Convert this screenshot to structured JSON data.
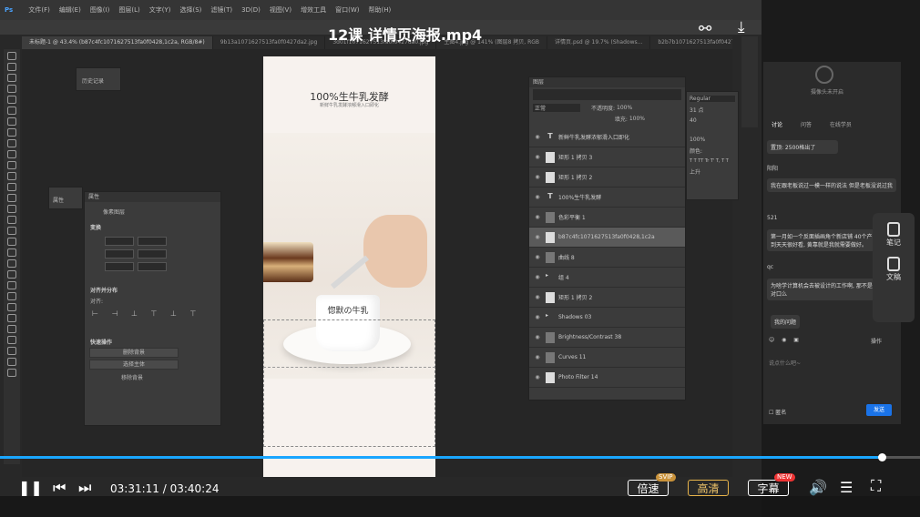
{
  "video": {
    "title": "12课 详情页海报.mp4",
    "timecode": "03:31:11 / 03:40:24",
    "progress": 0.958,
    "speed_label": "倍速",
    "speed_badge": "SVIP",
    "quality_label": "高清",
    "subtitle_label": "字幕",
    "subtitle_badge": "NEW"
  },
  "ps": {
    "menu": [
      "文件(F)",
      "编辑(E)",
      "图像(I)",
      "图层(L)",
      "文字(Y)",
      "选择(S)",
      "滤镜(T)",
      "3D(D)",
      "视图(V)",
      "增效工具",
      "窗口(W)",
      "帮助(H)"
    ],
    "tabs": [
      "未标题-1 @ 43.4% (b87c4fc1071627513fa0f0428,1c2a, RGB/8#)",
      "9b13a1071627513fa0f0427da2.jpg",
      "3d01f1071627513fa0f0427da0.jpg",
      "主图4.jpg @ 141% (图层8 拷贝, RGB",
      "详情页.psd @ 19.7% (Shadows...",
      "b2b7b1071627513fa0f0427c.8e"
    ],
    "history_label": "历史记录",
    "properties_collapsed_label": "属性",
    "properties": {
      "title": "属性",
      "subtitle": "像素图层",
      "transform_label": "变换",
      "align_label": "对齐并分布",
      "align_sub": "对齐:",
      "quick_label": "快速操作",
      "btn_remove_bg": "删除背景",
      "btn_select_subject": "选择主体",
      "btn_more": "...",
      "footer": "移除背景"
    },
    "layers": {
      "title": "图层",
      "blend_mode": "正常",
      "opacity_label": "不透明度:",
      "opacity_value": "100%",
      "fill_label": "填充:",
      "fill_value": "100%",
      "rows": [
        {
          "type": "text",
          "name": "新鲜牛乳发酵浓郁滑入口即化"
        },
        {
          "type": "shape",
          "name": "矩形 1 拷贝 3"
        },
        {
          "type": "shape",
          "name": "矩形 1 拷贝 2"
        },
        {
          "type": "text",
          "name": "100%生牛乳发酵"
        },
        {
          "type": "adj",
          "name": "色彩平衡 1"
        },
        {
          "type": "image",
          "name": "b87c4fc1071627513fa0f0428,1c2a"
        },
        {
          "type": "adj",
          "name": "曲线 8"
        },
        {
          "type": "group",
          "name": "组 4"
        },
        {
          "type": "shape",
          "name": "矩形 1 拷贝 2"
        },
        {
          "type": "group",
          "name": "Shadows 03"
        },
        {
          "type": "adj",
          "name": "Brightness/Contrast 38"
        },
        {
          "type": "adj",
          "name": "Curves 11"
        },
        {
          "type": "image",
          "name": "Photo Filter 14"
        }
      ]
    },
    "character": {
      "font_style": "Regular",
      "size": "31 点",
      "leading": "40",
      "tracking": "100%",
      "color_label": "颜色:",
      "style_row": "T T TT Tr T' T, T T",
      "extra": "上升"
    }
  },
  "doc": {
    "headline": "100%生牛乳发酵",
    "subline": "新鲜牛乳发酵浓郁滑入口即化",
    "cup_label": "惚默の牛乳"
  },
  "sidebar": {
    "status": "摄像头未开启",
    "tabs": [
      "讨论",
      "问答",
      "在线学员"
    ],
    "pinned": "置顶: 2500格出了",
    "messages": [
      {
        "user": "阳阳",
        "text": "我在跟老板说过一模一样的说法 但是老板没说过我"
      },
      {
        "user": "521",
        "text": "第一月如一个反面插画角个新店铺 40个产品, 要做到天天很好看, 黄靠就是我就需要做好。"
      },
      {
        "user": "qc",
        "text": "为啥学计算机会去被设计的工作啊, 那不是专业不对口么"
      }
    ],
    "reply_label": "我的问题",
    "action_label": "操作",
    "input_placeholder": "说点什么吧~",
    "anon_label": "匿名",
    "send_label": "发送",
    "note_label": "笔记",
    "draft_label": "文稿"
  }
}
